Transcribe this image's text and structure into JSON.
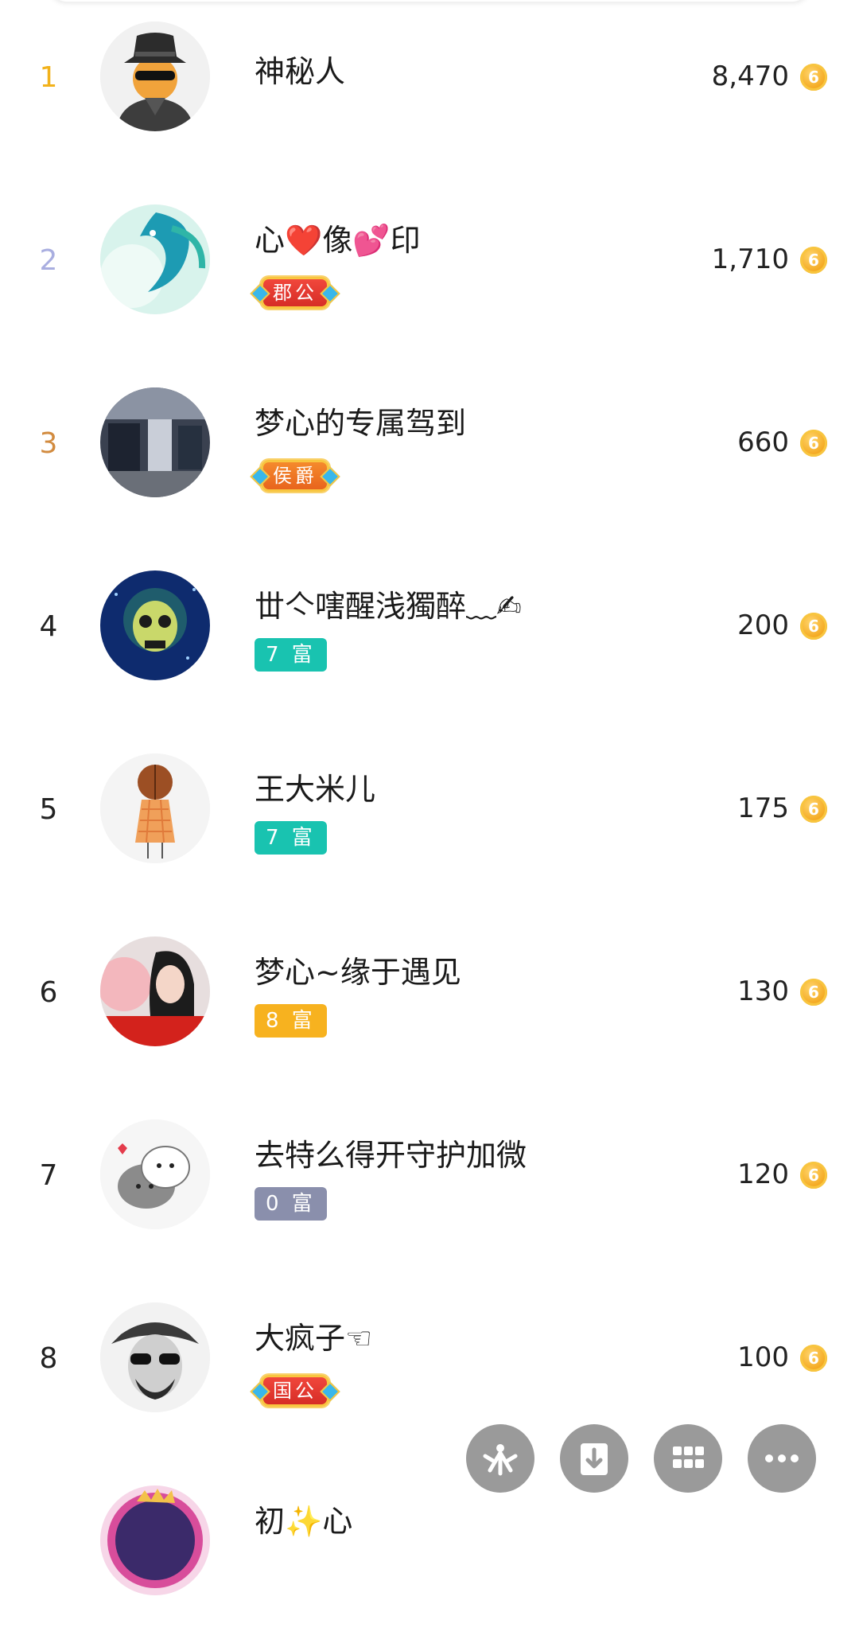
{
  "ranking": [
    {
      "rank": "1",
      "rank_style": "gold",
      "name": "神秘人",
      "badge": "",
      "badge_style": "",
      "amount": "8,470",
      "avatar": "mysterious-man-avatar"
    },
    {
      "rank": "2",
      "rank_style": "silver",
      "name": "心❤️像💕印",
      "badge": "郡公",
      "badge_style": "noble",
      "amount": "1,710",
      "avatar": "blue-dragon-avatar"
    },
    {
      "rank": "3",
      "rank_style": "bronze",
      "name": "梦心的专属驾到",
      "badge": "侯爵",
      "badge_style": "noble-orange",
      "amount": "660",
      "avatar": "mall-photo-avatar"
    },
    {
      "rank": "4",
      "rank_style": "plain",
      "name": "丗亽嗐醒浅獨醉﹏✍",
      "badge": "7 富",
      "badge_style": "teal",
      "amount": "200",
      "avatar": "skull-avatar"
    },
    {
      "rank": "5",
      "rank_style": "plain",
      "name": "王大米儿",
      "badge": "7 富",
      "badge_style": "teal",
      "amount": "175",
      "avatar": "girl-drawing-avatar"
    },
    {
      "rank": "6",
      "rank_style": "plain",
      "name": "梦心~缘于遇见",
      "badge": "8 富",
      "badge_style": "orange",
      "amount": "130",
      "avatar": "woman-photo-avatar"
    },
    {
      "rank": "7",
      "rank_style": "plain",
      "name": "去特么得开守护加微",
      "badge": "0 富",
      "badge_style": "gray",
      "amount": "120",
      "avatar": "cartoon-cats-avatar"
    },
    {
      "rank": "8",
      "rank_style": "plain",
      "name": "大疯子☜",
      "badge": "国公",
      "badge_style": "noble",
      "amount": "100",
      "avatar": "man-sunglasses-avatar"
    },
    {
      "rank": "",
      "rank_style": "plain",
      "name": "初✨心",
      "badge": "",
      "badge_style": "",
      "amount": "",
      "avatar": "anime-girl-avatar"
    }
  ],
  "coin_glyph": "6",
  "fab_buttons": [
    "share-icon",
    "download-icon",
    "grid-icon",
    "more-icon"
  ],
  "colors": {
    "gold_rank": "#f2b21b",
    "silver_rank": "#a9aee0",
    "bronze_rank": "#d28b3f",
    "coin": "#f3a51c",
    "fab": "#9a9a9a"
  }
}
